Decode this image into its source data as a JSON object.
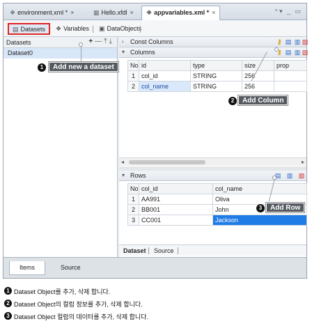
{
  "editor_tabs": [
    {
      "label": "environment.xml *",
      "icon": "xml-icon",
      "close": "×"
    },
    {
      "label": "Hello.xfdl",
      "icon": "form-icon",
      "close": "×"
    },
    {
      "label": "appvariables.xml *",
      "icon": "xml-icon",
      "close": "×"
    }
  ],
  "window_controls": "⁼▾ _ ▭",
  "sub_tabs": [
    {
      "label": "Datasets",
      "icon": "dataset-icon"
    },
    {
      "label": "Variables",
      "icon": "variables-icon"
    },
    {
      "label": "DataObjects",
      "icon": "dataobjects-icon"
    }
  ],
  "datasets_panel": {
    "title": "Datasets",
    "tools": {
      "add": "+",
      "remove": "—",
      "import": "⤒",
      "export": "⤓"
    },
    "items": [
      "Dataset0"
    ]
  },
  "const_columns": {
    "title": "Const Columns",
    "collapse_icon": "›"
  },
  "columns": {
    "title": "Columns",
    "headers": [
      "No",
      "id",
      "type",
      "size",
      "prop"
    ],
    "rows": [
      {
        "no": "1",
        "id": "col_id",
        "type": "STRING",
        "size": "256",
        "prop": ""
      },
      {
        "no": "2",
        "id": "col_name",
        "type": "STRING",
        "size": "256",
        "prop": ""
      }
    ]
  },
  "rows_section": {
    "title": "Rows",
    "headers": [
      "No",
      "col_id",
      "col_name"
    ],
    "rows": [
      {
        "no": "1",
        "col_id": "AA991",
        "col_name": "Oliva"
      },
      {
        "no": "2",
        "col_id": "BB001",
        "col_name": "John"
      },
      {
        "no": "3",
        "col_id": "CC001",
        "col_name": "Jackson"
      }
    ],
    "tabs": [
      "Dataset",
      "Source"
    ]
  },
  "bottom_tabs": [
    "Items",
    "Source"
  ],
  "callouts": [
    {
      "num": "1",
      "label": "Add new a dataset"
    },
    {
      "num": "2",
      "label": "Add Column"
    },
    {
      "num": "3",
      "label": "Add Row"
    }
  ],
  "notes": [
    {
      "num": "1",
      "text": "Dataset Object를 추가, 삭제 합니다."
    },
    {
      "num": "2",
      "text": "Dataset Object의 컬럼 정보를 추가, 삭제 합니다."
    },
    {
      "num": "3",
      "text": "Dataset Object 컬럼의 데이터를 추가, 삭제 합니다."
    }
  ],
  "colors": {
    "highlight_border": "#e02424",
    "selected_row": "#d7e7f8",
    "edit_cell": "#1f7be6",
    "callout_bg": "#555a60"
  }
}
